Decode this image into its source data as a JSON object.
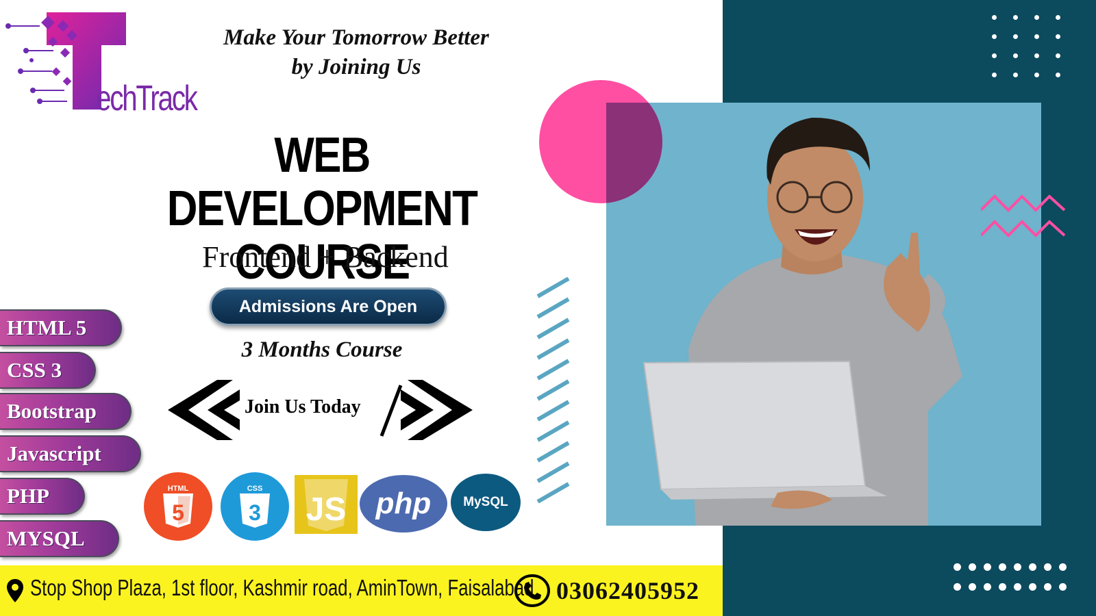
{
  "brand": {
    "name": "echTrack"
  },
  "tagline": {
    "line1": "Make Your Tomorrow Better",
    "line2": "by Joining Us"
  },
  "headline": {
    "line1": "WEB DEVELOPMENT",
    "line2": "COURSE"
  },
  "subtitle": "Frontend + Backend",
  "admissions_label": "Admissions Are Open",
  "duration": "3 Months Course",
  "cta": "Join Us Today",
  "skills": [
    "HTML 5",
    "CSS 3",
    "Bootstrap",
    "Javascript",
    "PHP",
    "MYSQL"
  ],
  "tech_logos": {
    "html": "HTML",
    "css": "CSS",
    "php": "php",
    "mysql": "MySQL"
  },
  "footer": {
    "address": "Stop Shop Plaza, 1st floor, Kashmir road, AminTown, Faisalabad",
    "phone": "03062405952"
  },
  "colors": {
    "teal": "#0c4a5e",
    "pink": "#ff4fa3",
    "purple": "#a13b9a",
    "yellow": "#fbf31f",
    "sky": "#6fb3cc"
  }
}
